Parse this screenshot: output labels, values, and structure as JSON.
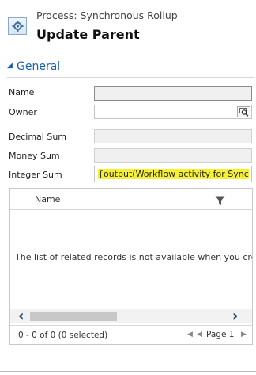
{
  "header": {
    "subtitle": "Process: Synchronous Rollup",
    "title": "Update Parent"
  },
  "section": {
    "toggle_glyph": "◢",
    "title": "General"
  },
  "form": {
    "name_label": "Name",
    "owner_label": "Owner",
    "decimal_sum_label": "Decimal Sum",
    "money_sum_label": "Money Sum",
    "integer_sum_label": "Integer Sum",
    "integer_sum_value": "{output(Workflow activity for Sync",
    "owner_lookup_icon": "lookup-icon"
  },
  "grid": {
    "column_name": "Name",
    "filter_icon": "filter-icon",
    "empty_message": "The list of related records is not available when you create a p",
    "scroll_left_glyph": "‹",
    "scroll_right_glyph": "›",
    "records_count": "0 - 0 of 0 (0 selected)",
    "first_page_glyph": "|◀",
    "prev_page_glyph": "◀",
    "page_label": "Page 1",
    "next_page_glyph": "▶"
  },
  "colors": {
    "accent": "#1a5fb4",
    "highlight": "#f6f033"
  }
}
